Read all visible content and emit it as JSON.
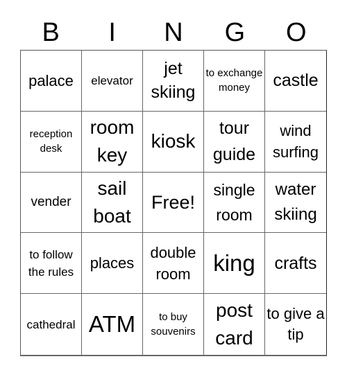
{
  "header": {
    "letters": [
      "B",
      "I",
      "N",
      "G",
      "O"
    ]
  },
  "grid": {
    "cells": [
      "palace",
      "elevator",
      "jet skiing",
      "to exchange money",
      "castle",
      "reception desk",
      "room key",
      "kiosk",
      "tour guide",
      "wind surfing",
      "vender",
      "sail boat",
      "Free!",
      "single room",
      "water skiing",
      "to follow the rules",
      "places",
      "double room",
      "king",
      "crafts",
      "cathedral",
      "ATM",
      "to buy souvenirs",
      "post card",
      "to give a tip"
    ]
  }
}
